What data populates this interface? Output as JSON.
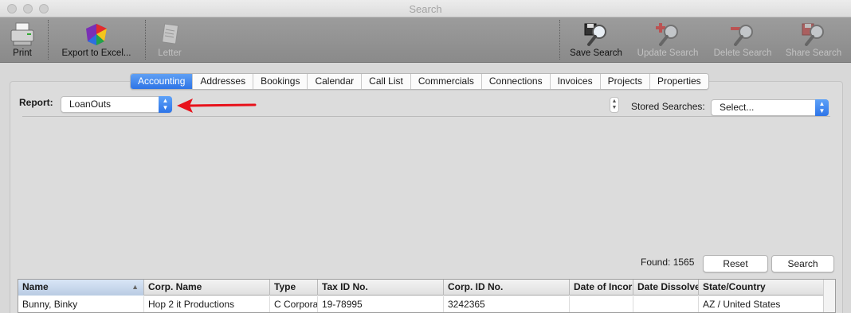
{
  "window": {
    "title": "Search"
  },
  "toolbar": {
    "print": "Print",
    "export": "Export to Excel...",
    "letter": "Letter",
    "save_search": "Save Search",
    "update_search": "Update Search",
    "delete_search": "Delete Search",
    "share_search": "Share Search"
  },
  "tabs": [
    "Accounting",
    "Addresses",
    "Bookings",
    "Calendar",
    "Call List",
    "Commercials",
    "Connections",
    "Invoices",
    "Projects",
    "Properties"
  ],
  "active_tab": "Accounting",
  "report": {
    "label": "Report:",
    "value": "LoanOuts"
  },
  "stored_searches": {
    "label": "Stored Searches:",
    "value": "Select..."
  },
  "results": {
    "found": "Found: 1565",
    "reset": "Reset",
    "search": "Search"
  },
  "table": {
    "columns": [
      "Name",
      "Corp. Name",
      "Type",
      "Tax ID No.",
      "Corp. ID No.",
      "Date of Incor",
      "Date Dissolve",
      "State/Country"
    ],
    "rows": [
      [
        "Bunny, Binky",
        "Hop 2 it Productions",
        "C Corpora",
        "19-78995",
        "3242365",
        "",
        "",
        "AZ / United States"
      ]
    ]
  },
  "colors": {
    "accent": "#2e74e6",
    "arrow": "#e8121b"
  },
  "icons": [
    "printer-icon",
    "excel-chart-icon",
    "letter-icon",
    "save-search-icon",
    "update-search-icon",
    "delete-search-icon",
    "share-search-icon",
    "sort-ascending-icon",
    "chevron-updown-icon"
  ]
}
